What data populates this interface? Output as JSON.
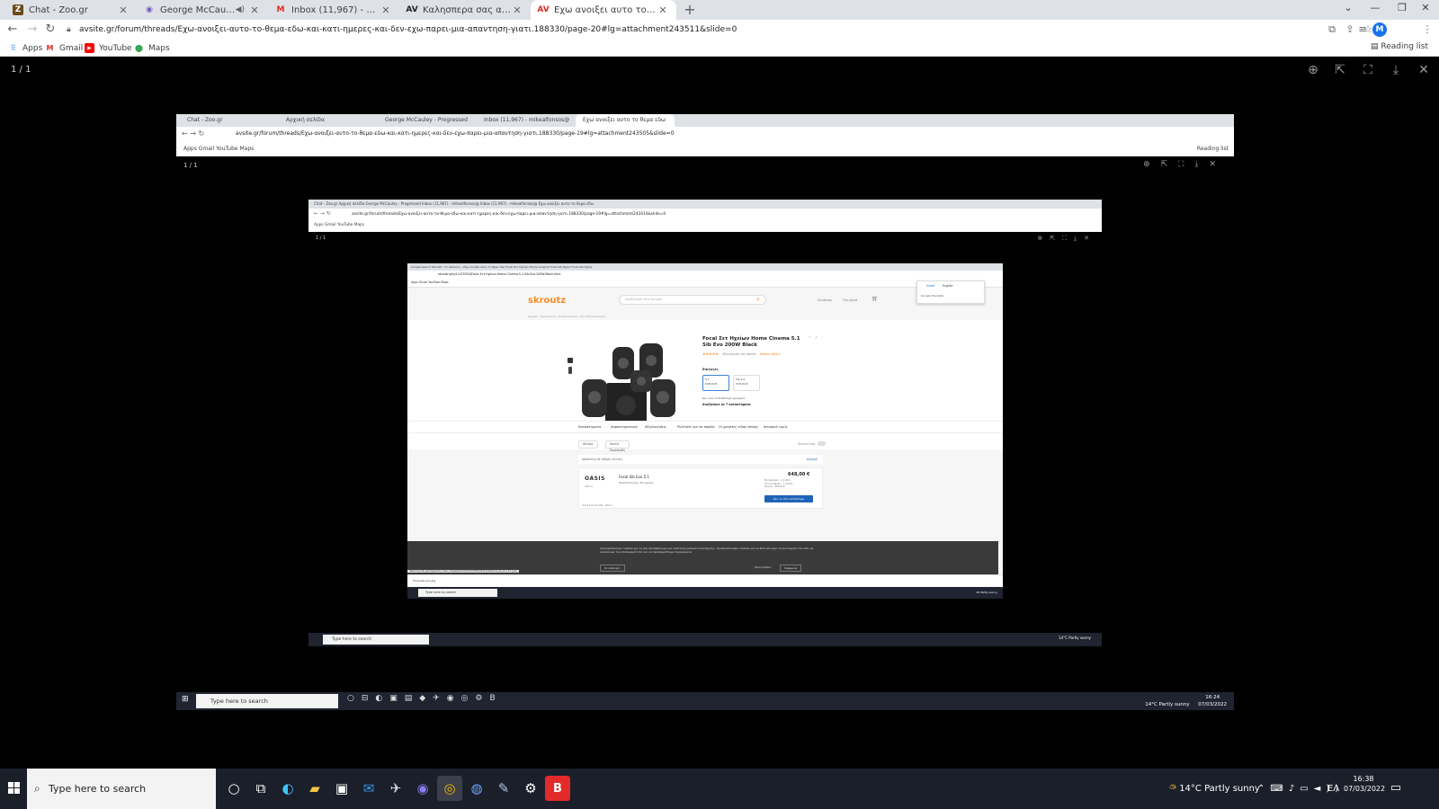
{
  "browser": {
    "tabs": [
      {
        "label": "Chat - Zoo.gr",
        "icon": "chat-favicon"
      },
      {
        "label": "George McCauley - Progress",
        "icon": "audio-favicon"
      },
      {
        "label": "Inbox (11,967) - mikealfonsos@",
        "icon": "gmail-favicon"
      },
      {
        "label": "Καλησπερα σας αναζητω ενα",
        "icon": "avsite-favicon"
      },
      {
        "label": "Εχω ανοιξει αυτο το θεμα εδω",
        "icon": "avsite-favicon"
      }
    ],
    "url": "avsite.gr/forum/threads/Εχω-ανοιξει-αυτο-το-θεμα-εδω-και-κατι-ημερες-και-δεν-εχω-παρει-μια-απαντηση-γιατι.188330/page-20#lg=attachment243511&slide=0",
    "profile_initial": "M",
    "bookmarks": [
      {
        "label": "Apps",
        "icon": "apps-grid-icon"
      },
      {
        "label": "Gmail",
        "icon": "gmail-icon"
      },
      {
        "label": "YouTube",
        "icon": "youtube-icon"
      },
      {
        "label": "Maps",
        "icon": "maps-icon"
      }
    ],
    "reading_list": "Reading list"
  },
  "viewer": {
    "counter": "1 / 1"
  },
  "shot1": {
    "tabs": [
      "Chat - Zoo.gr",
      "Αρχική σελίδα",
      "George McCauley - Progressed",
      "Inbox (11,967) - mikealfonsos@",
      "Εχω ανοιξει αυτο το θεμα εδω"
    ],
    "url": "avsite.gr/forum/threads/Εχω-ανοιξει-αυτο-το-θεμα-εδω-και-κατι-ημερες-και-δεν-εχω-παρει-μια-απαντηση-γιατι.188330/page-19#lg=attachment243505&slide=0",
    "bookmarks": "Apps   Gmail   YouTube   Maps",
    "reading_list": "Reading list",
    "counter": "1 / 1",
    "search": "Type here to search",
    "tray": "14°C  Partly sunny",
    "time": "16:24",
    "date": "07/03/2022"
  },
  "shot2": {
    "tabs": "Chat - Zoo.gr    Αρχική σελίδα    George McCauley - Progressed    Inbox (11,967) - mikealfonsos@    Inbox (11,967) - mikealfonsos@    Εχω ανοιξει αυτο το θεμα εδω",
    "url": "avsite.gr/forum/threads/Εχω-ανοιξει-αυτο-το-θεμα-εδω-και-κατι-ημερες-και-δεν-εχω-παρει-μια-απαντηση-γιατι.188330/page-19#lg=attachment243414&slide=0",
    "bookmarks": "Apps   Gmail   YouTube   Maps",
    "counter": "1 / 1",
    "search": "Type here to search",
    "tray": "14°C  Partly sunny"
  },
  "shot3": {
    "tabs": "Google Search   Skroutz - Το απόλυτο...   Εχω ανοιξει αυτο το θεμα εδω   Focal Σετ Ηχείων Home Cinema   Focal Sib Ηχεία   Focal Sib Ηχεία",
    "url": "skroutz.gr/s/12470354/Focal-Σετ-Ηχείων-Home-Cinema-5-1-Sib-Evo-200W-Black.html",
    "bookmarks": "Apps   Gmail   YouTube   Maps",
    "logo": "skroutz",
    "search_placeholder": "Αναζήτηση στο skroutz",
    "nav": [
      "Σύνδεση",
      "Για μένα"
    ],
    "breadcrumb": "Αρχική  ›  Τεχνολογία  ›  Home Cinema  ›  Σετ Home Cinema",
    "lang_popup": {
      "tab_a": "Greek",
      "tab_b": "English",
      "body": "Google Translate"
    },
    "product": {
      "title": "Focal Σετ Ηχείων Home Cinema 5.1 Sib Evo 200W Black",
      "stars": "★★★★★",
      "reviews": "Αξιολόγηση του προϊόν",
      "compare": "Κάποιο σχόλιο",
      "options_title": "Επιλογές",
      "options": [
        {
          "name": "5.1",
          "price": "648,00 €"
        },
        {
          "name": "Sib 2.0",
          "price": "370,00 €"
        }
      ],
      "note": "Δες όλα τα διαθέσιμα χρώματα",
      "link": "Αναζήτησε σε 7 καταστήματα"
    },
    "tabs_row": [
      "Καταστήματα",
      "Χαρακτηριστικά",
      "Αξιολογήσεις",
      "Ρωτήστε για το προϊόν",
      "Οι χρήστες είδαν επίσης",
      "Ιστορικό τιμής"
    ],
    "filters": [
      "Φίλτρα",
      "Κοντά Παραλαβή"
    ],
    "toggle_label": "Skroutz Ιγος",
    "ship_to": "Αποστολή σε  Αθήνα, Αττική",
    "ship_change": "Αλλαγή",
    "shop": {
      "logo": "OASIS",
      "sub": "Αθήνα",
      "name": "Focal Sib Evo 5.1",
      "shipping": "Παράδοση έως 30 ημέρες",
      "price": "648,00 €",
      "breakdown": "Μεταφορικά   + 0,00 €\nΑντικαταβολή   + 0,00 €\nΣύνολο   648,00 €",
      "button": "Δες το στο κατάστημα",
      "foot": "★★★★★   Καλάθι, Αθήνα"
    },
    "cookie_text": "Χρησιμοποιούμε cookies για να σου προσφέρουμε μια καλύτερη εμπειρία περιήγησης. Χρησιμοποιούμε cookies για να βελτιώνουμε τη λειτουργία του site, να αναλύουμε την επισκεψιμότητα και να προσαρμόζουμε περιεχόμενο.",
    "cookie_buttons": [
      "Οι επιλογές",
      "Προτιμήσεις",
      "Συμφωνώ"
    ],
    "status_url": "https://a.scdn.gr/images/sku_main_images/012470/12470354/20211016/focal_sib_evo_5.1.jpeg",
    "download": "Focal-sib-evo.jpg",
    "search": "Type here to search",
    "tray": "PC  Partly sunny"
  },
  "taskbar": {
    "search": "Type here to search",
    "weather": "14°C  Partly sunny",
    "lang": "ΕΛ",
    "time": "16:38",
    "date": "07/03/2022"
  }
}
